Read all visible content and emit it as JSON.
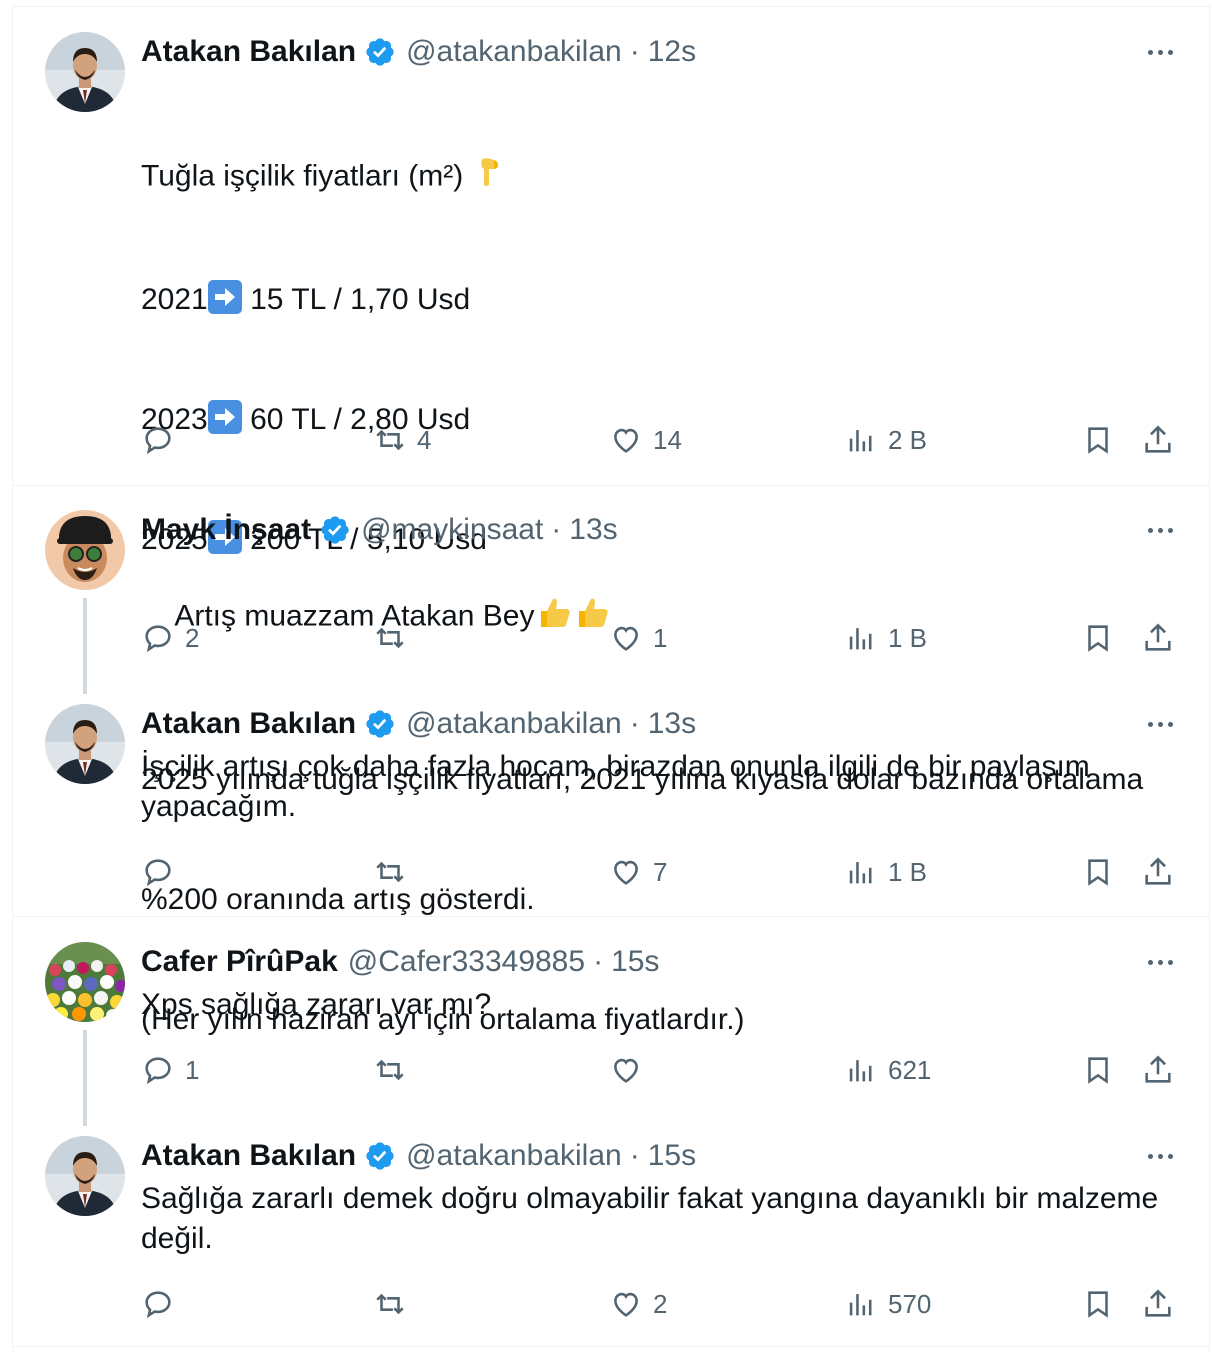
{
  "colors": {
    "verified": "#1d9bf0",
    "text": "#0f1419",
    "muted": "#536471",
    "separator": "#eff3f4",
    "thread_line": "#cfd9de"
  },
  "tweets": [
    {
      "name": "Atakan Bakılan",
      "handle": "@atakanbakilan",
      "time": "12s",
      "verified": true,
      "lines": [
        "Tuğla işçilik fiyatları (m²)",
        "2021",
        "15 TL / 1,70 Usd",
        "2023",
        "60 TL / 2,80 Usd",
        "2025",
        "200 TL / 5,10 Usd",
        "2025 yılında tuğla işçilik fiyatları, 2021 yılına kıyasla dolar bazında ortalama",
        "%200 oranında artış gösterdi.",
        "(Her yılın haziran ayı için ortalama fiyatlardır.)"
      ],
      "replies": "",
      "retweets": "4",
      "likes": "14",
      "views": "2 B"
    },
    {
      "name": "Mayk İnşaat",
      "handle": "@maykinsaat",
      "time": "13s",
      "verified": true,
      "text": "Artış muazzam Atakan Bey",
      "replies": "2",
      "retweets": "",
      "likes": "1",
      "views": "1 B"
    },
    {
      "name": "Atakan Bakılan",
      "handle": "@atakanbakilan",
      "time": "13s",
      "verified": true,
      "text": "İşçilik artışı çok daha fazla hocam, birazdan onunla ilgili de bir paylaşım\nyapacağım.",
      "replies": "",
      "retweets": "",
      "likes": "7",
      "views": "1 B"
    },
    {
      "name": "Cafer PîrûPak",
      "handle": "@Cafer33349885",
      "time": "15s",
      "verified": false,
      "text": "Xps sağlığa zararı var mı?",
      "replies": "1",
      "retweets": "",
      "likes": "",
      "views": "621"
    },
    {
      "name": "Atakan Bakılan",
      "handle": "@atakanbakilan",
      "time": "15s",
      "verified": true,
      "text": "Sağlığa zararlı demek doğru olmayabilir fakat yangına dayanıklı bir malzeme\ndeğil.",
      "replies": "",
      "retweets": "",
      "likes": "2",
      "views": "570"
    }
  ]
}
